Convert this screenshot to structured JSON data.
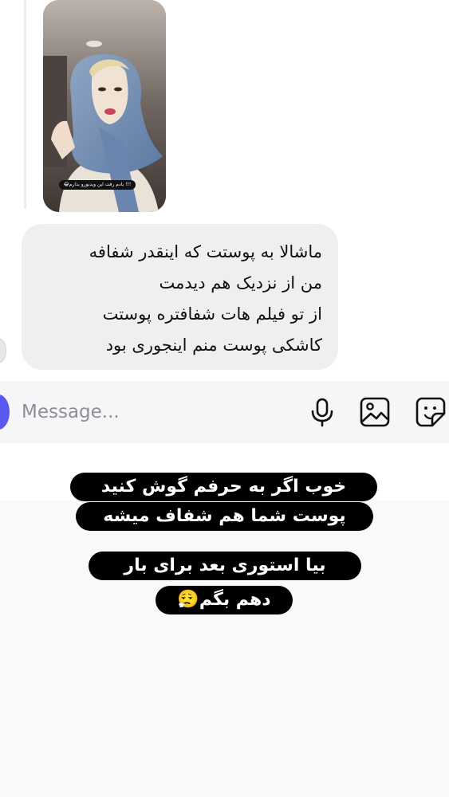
{
  "media": {
    "caption": "!!! یادم رفت این ویدیورو بذارم😂"
  },
  "message": {
    "lines": [
      "ماشالا به پوستت که اینقدر شفافه",
      "من از نزدیک هم دیدمت",
      "از تو فیلم هات شفافتره پوستت",
      "کاشکی پوست منم اینجوری بود"
    ]
  },
  "composer": {
    "placeholder": "Message...",
    "icons": [
      "camera-icon",
      "microphone-icon",
      "gallery-icon",
      "sticker-icon"
    ],
    "accent_color": "#5b58f0"
  },
  "story_text": {
    "block1": [
      "خوب اگر به حرفم گوش کنید",
      "پوست شما هم شفاف میشه"
    ],
    "block2": [
      "بیا استوری بعد برای بار",
      "دهم بگم😮‍💨"
    ]
  }
}
